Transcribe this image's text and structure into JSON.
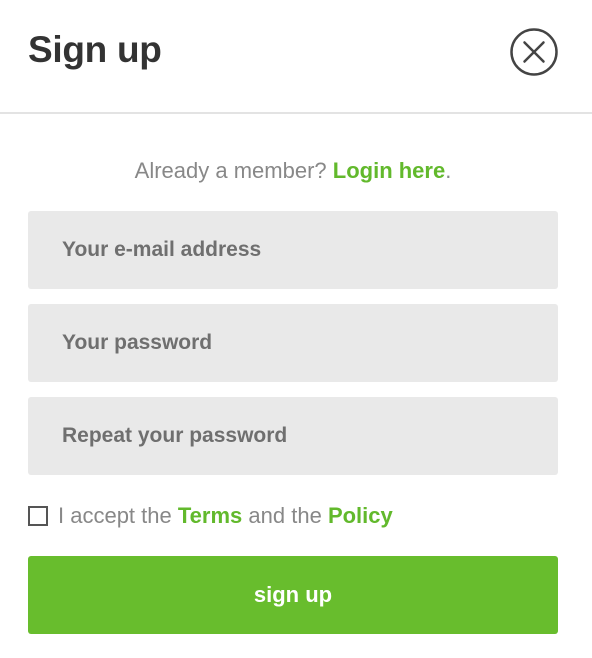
{
  "header": {
    "title": "Sign up",
    "close_icon": "close-circle-x"
  },
  "member": {
    "text": "Already a member?",
    "link": "Login here",
    "suffix": "."
  },
  "form": {
    "email_placeholder": "Your e-mail address",
    "password_placeholder": "Your password",
    "repeat_placeholder": "Repeat your password"
  },
  "terms": {
    "prefix": "I accept the",
    "terms_link": "Terms",
    "middle": "and the",
    "policy_link": "Policy",
    "checked": false
  },
  "submit": {
    "label": "sign up"
  },
  "colors": {
    "accent": "#68bd2d",
    "link": "#62b92c",
    "field_bg": "#e9e9e9",
    "title": "#333333",
    "muted_text": "#888888"
  }
}
